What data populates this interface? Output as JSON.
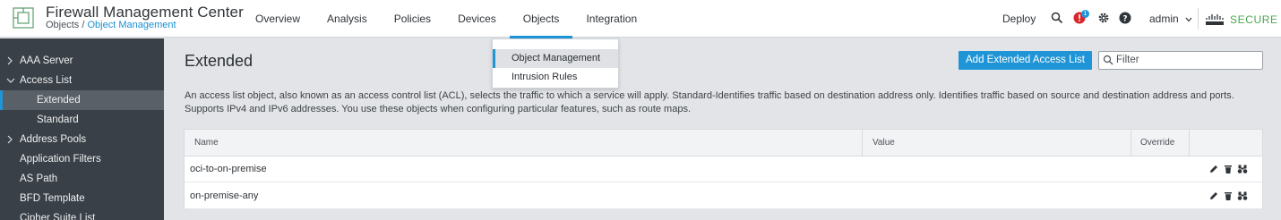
{
  "header": {
    "app_title": "Firewall Management Center",
    "breadcrumb_root": "Objects",
    "breadcrumb_sep": " / ",
    "breadcrumb_current": "Object Management",
    "nav": [
      {
        "label": "Overview"
      },
      {
        "label": "Analysis"
      },
      {
        "label": "Policies"
      },
      {
        "label": "Devices"
      },
      {
        "label": "Objects"
      },
      {
        "label": "Integration"
      }
    ],
    "deploy_label": "Deploy",
    "notification_count": "1",
    "user_label": "admin",
    "brand_label": "SECURE",
    "colors": {
      "accent": "#1f94d6",
      "alert": "#d9262c",
      "brand_green": "#4aa74f"
    }
  },
  "objects_menu": {
    "items": [
      {
        "label": "Object Management"
      },
      {
        "label": "Intrusion Rules"
      }
    ]
  },
  "sidebar": {
    "items": [
      {
        "label": "AAA Server"
      },
      {
        "label": "Access List"
      },
      {
        "label": "Extended"
      },
      {
        "label": "Standard"
      },
      {
        "label": "Address Pools"
      },
      {
        "label": "Application Filters"
      },
      {
        "label": "AS Path"
      },
      {
        "label": "BFD Template"
      },
      {
        "label": "Cipher Suite List"
      }
    ]
  },
  "main": {
    "title": "Extended",
    "add_button": "Add Extended Access List",
    "filter_placeholder": "Filter",
    "description_line1": "An access list object, also known as an access control list (ACL), selects the traffic to which a service will apply. Standard-Identifies traffic based on destination address only. Identifies traffic based on source and destination address and ports.",
    "description_line2": "Supports IPv4 and IPv6 addresses. You use these objects when configuring particular features, such as route maps.",
    "table": {
      "columns": [
        "Name",
        "Value",
        "Override"
      ],
      "rows": [
        {
          "name": "oci-to-on-premise",
          "value": "",
          "override": ""
        },
        {
          "name": "on-premise-any",
          "value": "",
          "override": ""
        }
      ]
    }
  }
}
